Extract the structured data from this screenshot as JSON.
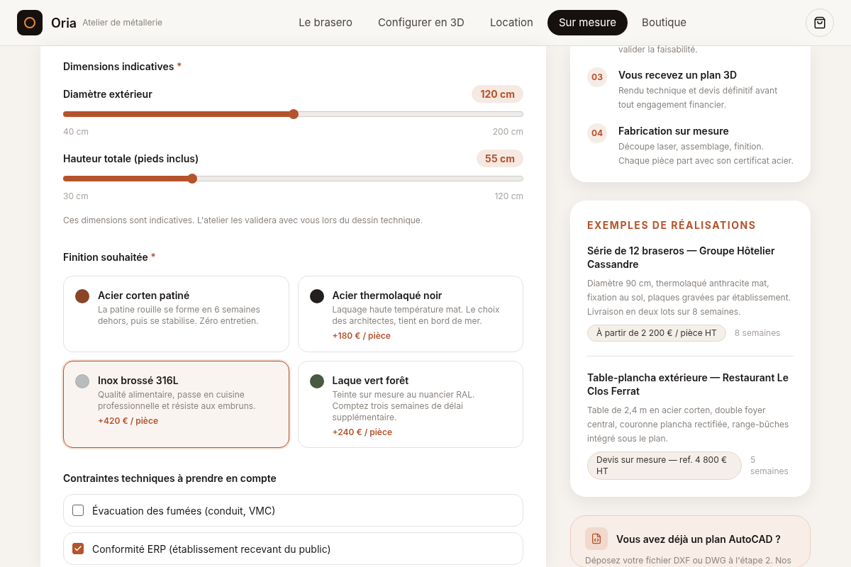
{
  "header": {
    "brand": "Oria",
    "tagline": "Atelier de métallerie",
    "nav": [
      {
        "label": "Le brasero",
        "selected": false
      },
      {
        "label": "Configurer en 3D",
        "selected": false
      },
      {
        "label": "Location",
        "selected": false
      },
      {
        "label": "Sur mesure",
        "selected": true
      },
      {
        "label": "Boutique",
        "selected": false
      }
    ]
  },
  "form": {
    "dimensions": {
      "title": "Dimensions indicatives",
      "required_mark": "*",
      "sliders": [
        {
          "label": "Diamètre extérieur",
          "reading": "120 cm",
          "level": 0.5,
          "min": "40 cm",
          "max": "200 cm"
        },
        {
          "label": "Hauteur totale (pieds inclus)",
          "reading": "55 cm",
          "level": 0.28,
          "min": "30 cm",
          "max": "120 cm"
        }
      ],
      "note": "Ces dimensions sont indicatives. L'atelier les validera avec vous lors du dessin technique."
    },
    "finish": {
      "title": "Finition souhaitée",
      "required_mark": "*",
      "options": [
        {
          "name": "Acier corten patiné",
          "description": "La patine rouille se forme en 6 semaines dehors, puis se stabilise. Zéro entretien.",
          "color": "#8b4526",
          "selected": false
        },
        {
          "name": "Acier thermolaqué noir",
          "description": "Laquage haute température mat. Le choix des architectes, tient en bord de mer.",
          "price": "+180 € / pièce",
          "color": "#231f1f",
          "selected": false
        },
        {
          "name": "Inox brossé 316L",
          "description": "Qualité alimentaire, passe en cuisine professionnelle et résiste aux embruns.",
          "price": "+420 € / pièce",
          "color": "#b8bcbd",
          "selected": true
        },
        {
          "name": "Laque vert forêt",
          "description": "Teinte sur mesure au nuancier RAL. Comptez trois semaines de délai supplémentaire.",
          "price": "+240 € / pièce",
          "color": "#4a5a40",
          "selected": false
        }
      ]
    },
    "constraints": {
      "title": "Contraintes techniques à prendre en compte",
      "items": [
        {
          "label": "Évacuation des fumées (conduit, VMC)",
          "checked": false
        },
        {
          "label": "Conformité ERP (établissement recevant du public)",
          "checked": true
        }
      ]
    }
  },
  "steps": {
    "partial_text": "valider la faisabilité.",
    "items": [
      {
        "number": "03",
        "title": "Vous recevez un plan 3D",
        "text": "Rendu technique et devis définitif avant tout engagement financier."
      },
      {
        "number": "04",
        "title": "Fabrication sur mesure",
        "text": "Découpe laser, assemblage, finition. Chaque pièce part avec son certificat acier."
      }
    ]
  },
  "examples": {
    "title": "EXEMPLES DE RÉALISATIONS",
    "items": [
      {
        "title": "Série de 12 braseros — Groupe Hôtelier Cassandre",
        "text": "Diamètre 90 cm, thermolaqué anthracite mat, fixation au sol, plaques gravées par établissement. Livraison en deux lots sur 8 semaines.",
        "price": "À partir de 2 200 € / pièce HT",
        "delay": "8 semaines"
      },
      {
        "title": "Table-plancha extérieure — Restaurant Le Clos Ferrat",
        "text": "Table de 2,4 m en acier corten, double foyer central, couronne plancha rectifiée, range-bûches intégré sous le plan.",
        "price": "Devis sur mesure — ref. 4 800 € HT",
        "delay": "5 semaines"
      }
    ]
  },
  "autocad": {
    "title": "Vous avez déjà un plan AutoCAD ?",
    "text": "Déposez votre fichier DXF ou DWG à l'étape 2. Nos"
  }
}
